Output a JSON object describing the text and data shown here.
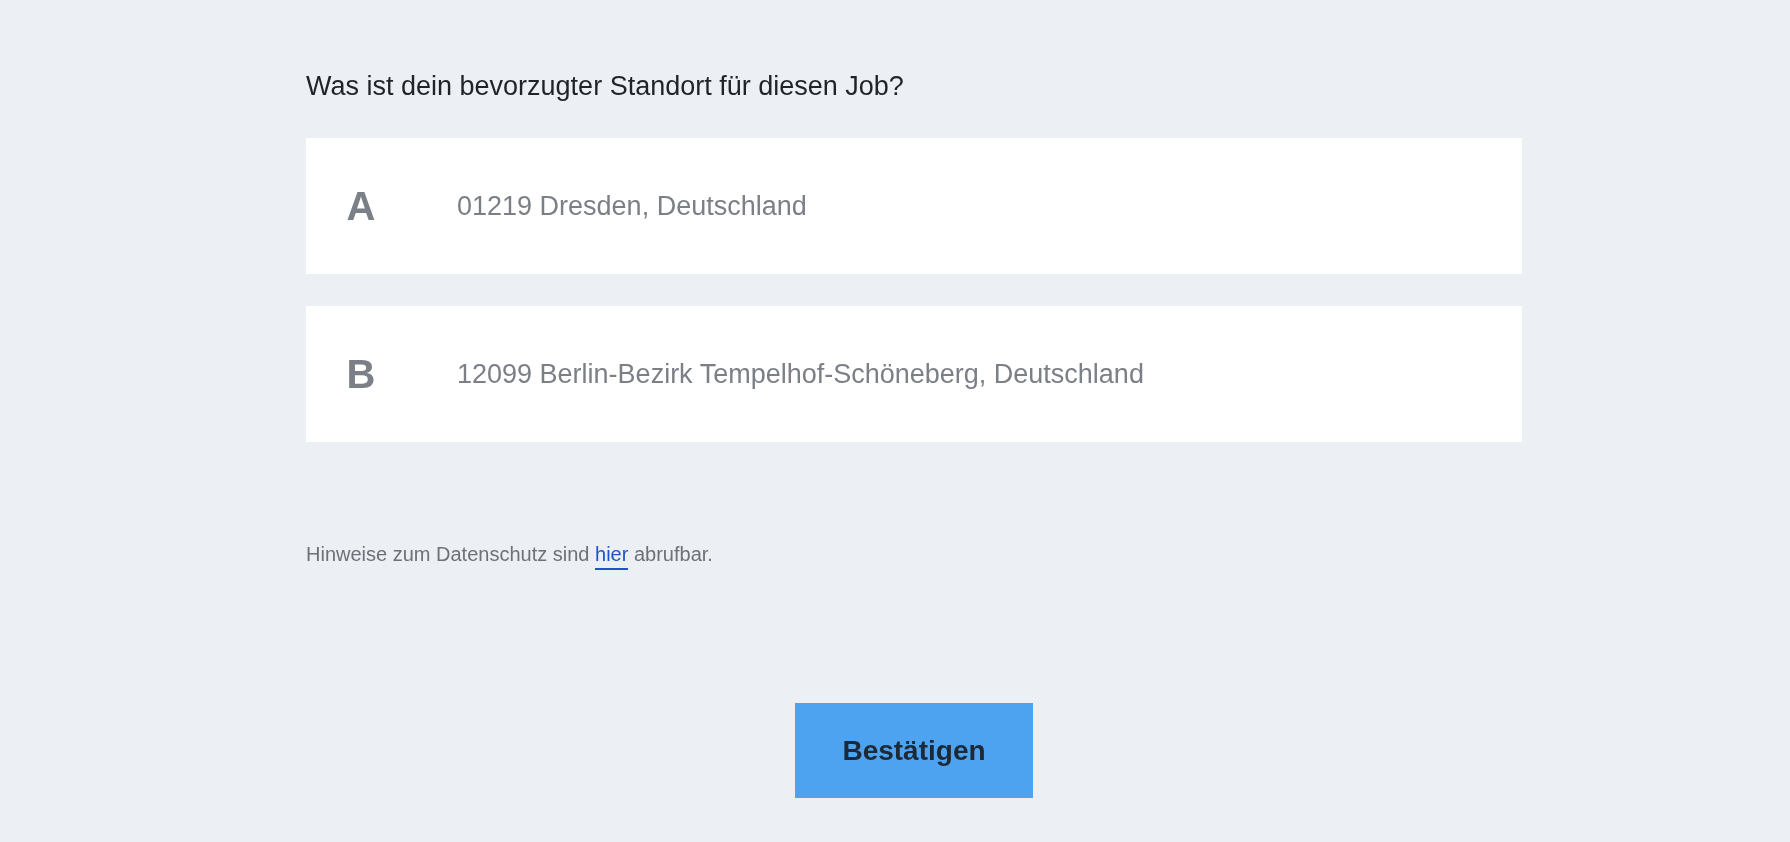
{
  "question": "Was ist dein bevorzugter Standort für diesen Job?",
  "options": [
    {
      "letter": "A",
      "label": "01219 Dresden, Deutschland"
    },
    {
      "letter": "B",
      "label": "12099 Berlin-Bezirk Tempelhof-Schöneberg, Deutschland"
    }
  ],
  "privacy": {
    "before": "Hinweise zum Datenschutz sind ",
    "link": "hier",
    "after": " abrufbar."
  },
  "confirm_button": "Bestätigen"
}
